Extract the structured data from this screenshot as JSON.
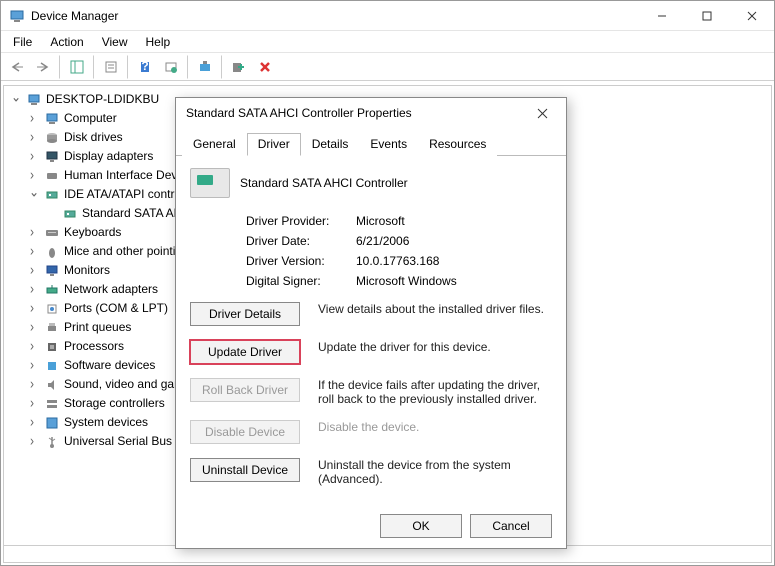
{
  "window": {
    "title": "Device Manager",
    "menu": [
      "File",
      "Action",
      "View",
      "Help"
    ]
  },
  "tree": {
    "root": "DESKTOP-LDIDKBU",
    "items": [
      {
        "label": "Computer",
        "icon": "computer-icon"
      },
      {
        "label": "Disk drives",
        "icon": "disk-icon"
      },
      {
        "label": "Display adapters",
        "icon": "display-icon"
      },
      {
        "label": "Human Interface Devices",
        "icon": "hid-icon"
      },
      {
        "label": "IDE ATA/ATAPI controllers",
        "icon": "ide-icon",
        "expanded": true,
        "children": [
          {
            "label": "Standard SATA AHCI Controller",
            "icon": "ide-icon"
          }
        ]
      },
      {
        "label": "Keyboards",
        "icon": "keyboard-icon"
      },
      {
        "label": "Mice and other pointing devices",
        "icon": "mouse-icon"
      },
      {
        "label": "Monitors",
        "icon": "monitor-icon"
      },
      {
        "label": "Network adapters",
        "icon": "network-icon"
      },
      {
        "label": "Ports (COM & LPT)",
        "icon": "ports-icon"
      },
      {
        "label": "Print queues",
        "icon": "print-icon"
      },
      {
        "label": "Processors",
        "icon": "cpu-icon"
      },
      {
        "label": "Software devices",
        "icon": "software-icon"
      },
      {
        "label": "Sound, video and game controllers",
        "icon": "sound-icon"
      },
      {
        "label": "Storage controllers",
        "icon": "storage-icon"
      },
      {
        "label": "System devices",
        "icon": "system-icon"
      },
      {
        "label": "Universal Serial Bus controllers",
        "icon": "usb-icon"
      }
    ]
  },
  "dialog": {
    "title": "Standard SATA AHCI Controller Properties",
    "tabs": [
      "General",
      "Driver",
      "Details",
      "Events",
      "Resources"
    ],
    "active_tab": "Driver",
    "device_name": "Standard SATA AHCI Controller",
    "fields": {
      "provider_label": "Driver Provider:",
      "provider_value": "Microsoft",
      "date_label": "Driver Date:",
      "date_value": "6/21/2006",
      "version_label": "Driver Version:",
      "version_value": "10.0.17763.168",
      "signer_label": "Digital Signer:",
      "signer_value": "Microsoft Windows"
    },
    "buttons": {
      "details": "Driver Details",
      "details_desc": "View details about the installed driver files.",
      "update": "Update Driver",
      "update_desc": "Update the driver for this device.",
      "rollback": "Roll Back Driver",
      "rollback_desc": "If the device fails after updating the driver, roll back to the previously installed driver.",
      "disable": "Disable Device",
      "disable_desc": "Disable the device.",
      "uninstall": "Uninstall Device",
      "uninstall_desc": "Uninstall the device from the system (Advanced).",
      "ok": "OK",
      "cancel": "Cancel"
    }
  }
}
